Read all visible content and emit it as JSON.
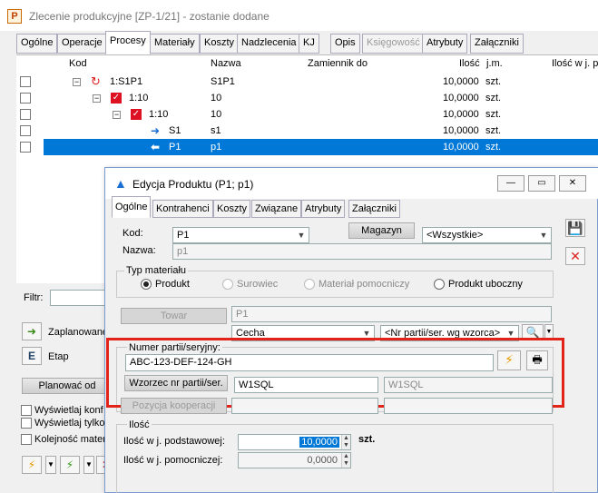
{
  "window": {
    "title": "Zlecenie produkcyjne  [ZP-1/21]  - zostanie dodane",
    "app_icon": "P"
  },
  "main_tabs": [
    {
      "label": "Ogólne",
      "state": "normal"
    },
    {
      "label": "Operacje",
      "state": "normal"
    },
    {
      "label": "Procesy",
      "state": "active"
    },
    {
      "label": "Materiały",
      "state": "normal"
    },
    {
      "label": "Koszty",
      "state": "normal"
    },
    {
      "label": "Nadzlecenia",
      "state": "normal"
    },
    {
      "label": "KJ",
      "state": "normal"
    },
    {
      "label": "Opis",
      "state": "normal"
    },
    {
      "label": "Księgowość",
      "state": "disabled"
    },
    {
      "label": "Atrybuty",
      "state": "normal"
    },
    {
      "label": "Załączniki",
      "state": "normal"
    }
  ],
  "grid": {
    "columns": [
      "Kod",
      "Nazwa",
      "Zamiennik do",
      "Ilość",
      "j.m.",
      "Ilość w j. p"
    ],
    "rows": [
      {
        "kod": "1:S1P1",
        "nazwa": "S1P1",
        "zamiennik": "",
        "ilosc": "10,0000",
        "jm": "szt.",
        "icon": "cycle-icon"
      },
      {
        "kod": "1:10",
        "nazwa": "10",
        "zamiennik": "",
        "ilosc": "10,0000",
        "jm": "szt.",
        "icon": "red-check-icon"
      },
      {
        "kod": "1:10",
        "nazwa": "10",
        "zamiennik": "",
        "ilosc": "10,0000",
        "jm": "szt.",
        "icon": "red-check-icon"
      },
      {
        "kod": "S1",
        "nazwa": "s1",
        "zamiennik": "",
        "ilosc": "10,0000",
        "jm": "szt.",
        "icon": "arrow-right-icon"
      },
      {
        "kod": "P1",
        "nazwa": "p1",
        "zamiennik": "",
        "ilosc": "10,0000",
        "jm": "szt.",
        "icon": "arrow-left-icon"
      }
    ]
  },
  "left_panel": {
    "filter_label": "Filtr:",
    "zaplanowane_label": "Zaplanowane",
    "etap_label": "Etap",
    "planowac_label": "Planować od",
    "checkbox1": "Wyświetlaj konf",
    "checkbox2": "Wyświetlaj tylko",
    "checkbox3": "Kolejność mater"
  },
  "dialog": {
    "title": "Edycja Produktu (P1; p1)",
    "tabs": [
      {
        "label": "Ogólne",
        "state": "active"
      },
      {
        "label": "Kontrahenci",
        "state": "normal"
      },
      {
        "label": "Koszty",
        "state": "normal"
      },
      {
        "label": "Związane",
        "state": "normal"
      },
      {
        "label": "Atrybuty",
        "state": "normal"
      },
      {
        "label": "Załączniki",
        "state": "normal"
      }
    ],
    "kod_label": "Kod:",
    "kod_value": "P1",
    "nazwa_label": "Nazwa:",
    "nazwa_value": "p1",
    "magazyn_button": "Magazyn",
    "magazyn_value": "<Wszystkie>",
    "typ_materialu_label": "Typ materiału",
    "typ_options": [
      {
        "label": "Produkt",
        "selected": true,
        "disabled": false
      },
      {
        "label": "Surowiec",
        "selected": false,
        "disabled": true
      },
      {
        "label": "Materiał pomocniczy",
        "selected": false,
        "disabled": true
      },
      {
        "label": "Produkt uboczny",
        "selected": false,
        "disabled": false
      }
    ],
    "towar_button": "Towar",
    "towar_value": "P1",
    "cecha_value": "Cecha",
    "nr_partii_wzorca_value": "<Nr partii/ser. wg wzorca>",
    "numer_partii_label": "Numer partii/seryjny:",
    "numer_partii_value": "ABC-123-DEF-124-GH",
    "wzorzec_button": "Wzorzec nr partii/ser.",
    "wzorzec_value1": "W1SQL",
    "wzorzec_value2": "W1SQL",
    "pozycja_kooperacji_button": "Pozycja kooperacji",
    "ilosc_group_label": "Ilość",
    "ilosc_podst_label": "Ilość w j. podstawowej:",
    "ilosc_podst_value": "10,0000",
    "ilosc_podst_unit": "szt.",
    "ilosc_pomoc_label": "Ilość w j. pomocniczej:",
    "ilosc_pomoc_value": "0,0000"
  },
  "colors": {
    "selection": "#0078d7",
    "highlight_box": "#e2231a",
    "accent_blue": "#1a6fd4"
  }
}
